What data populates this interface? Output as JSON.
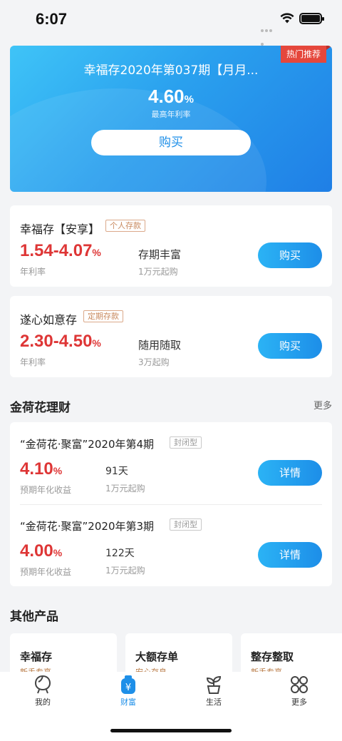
{
  "status_bar": {
    "time": "6:07"
  },
  "hero": {
    "badge": "热门推荐",
    "title": "幸福存2020年第037期【月月...",
    "rate_value": "4.60",
    "rate_unit": "%",
    "rate_label": "最高年利率",
    "button": "购买"
  },
  "products": [
    {
      "name": "幸福存【安享】",
      "tag": "个人存款",
      "rate_value": "1.54-4.07",
      "rate_unit": "%",
      "rate_label": "年利率",
      "feature": "存期丰富",
      "min": "1万元起购",
      "button": "购买"
    },
    {
      "name": "遂心如意存",
      "tag": "定期存款",
      "rate_value": "2.30-4.50",
      "rate_unit": "%",
      "rate_label": "年利率",
      "feature": "随用随取",
      "min": "3万起购",
      "button": "购买"
    }
  ],
  "lotus_section": {
    "title": "金荷花理财",
    "more": "更多",
    "items": [
      {
        "name": "“金荷花·聚富”2020年第4期",
        "tag": "封闭型",
        "rate_value": "4.10",
        "rate_unit": "%",
        "rate_label": "预期年化收益",
        "term": "91天",
        "min": "1万元起购",
        "button": "详情"
      },
      {
        "name": "“金荷花·聚富”2020年第3期",
        "tag": "封闭型",
        "rate_value": "4.00",
        "rate_unit": "%",
        "rate_label": "预期年化收益",
        "term": "122天",
        "min": "1万元起购",
        "button": "详情"
      }
    ]
  },
  "other_section": {
    "title": "其他产品",
    "items": [
      {
        "name": "幸福存",
        "sub": "新手专享"
      },
      {
        "name": "大额存单",
        "sub": "安心存息"
      },
      {
        "name": "整存整取",
        "sub": "新手专享"
      }
    ]
  },
  "tabbar": {
    "items": [
      {
        "label": "我的",
        "icon": "person-icon"
      },
      {
        "label": "财富",
        "icon": "wealth-icon"
      },
      {
        "label": "生活",
        "icon": "plant-icon"
      },
      {
        "label": "更多",
        "icon": "grid-icon"
      }
    ],
    "active": "财富",
    "accent": "#1e8fe8"
  },
  "colors": {
    "rate_red": "#de3636",
    "button_blue": "#1d8ee8",
    "tag_brown": "#c98a5f"
  }
}
